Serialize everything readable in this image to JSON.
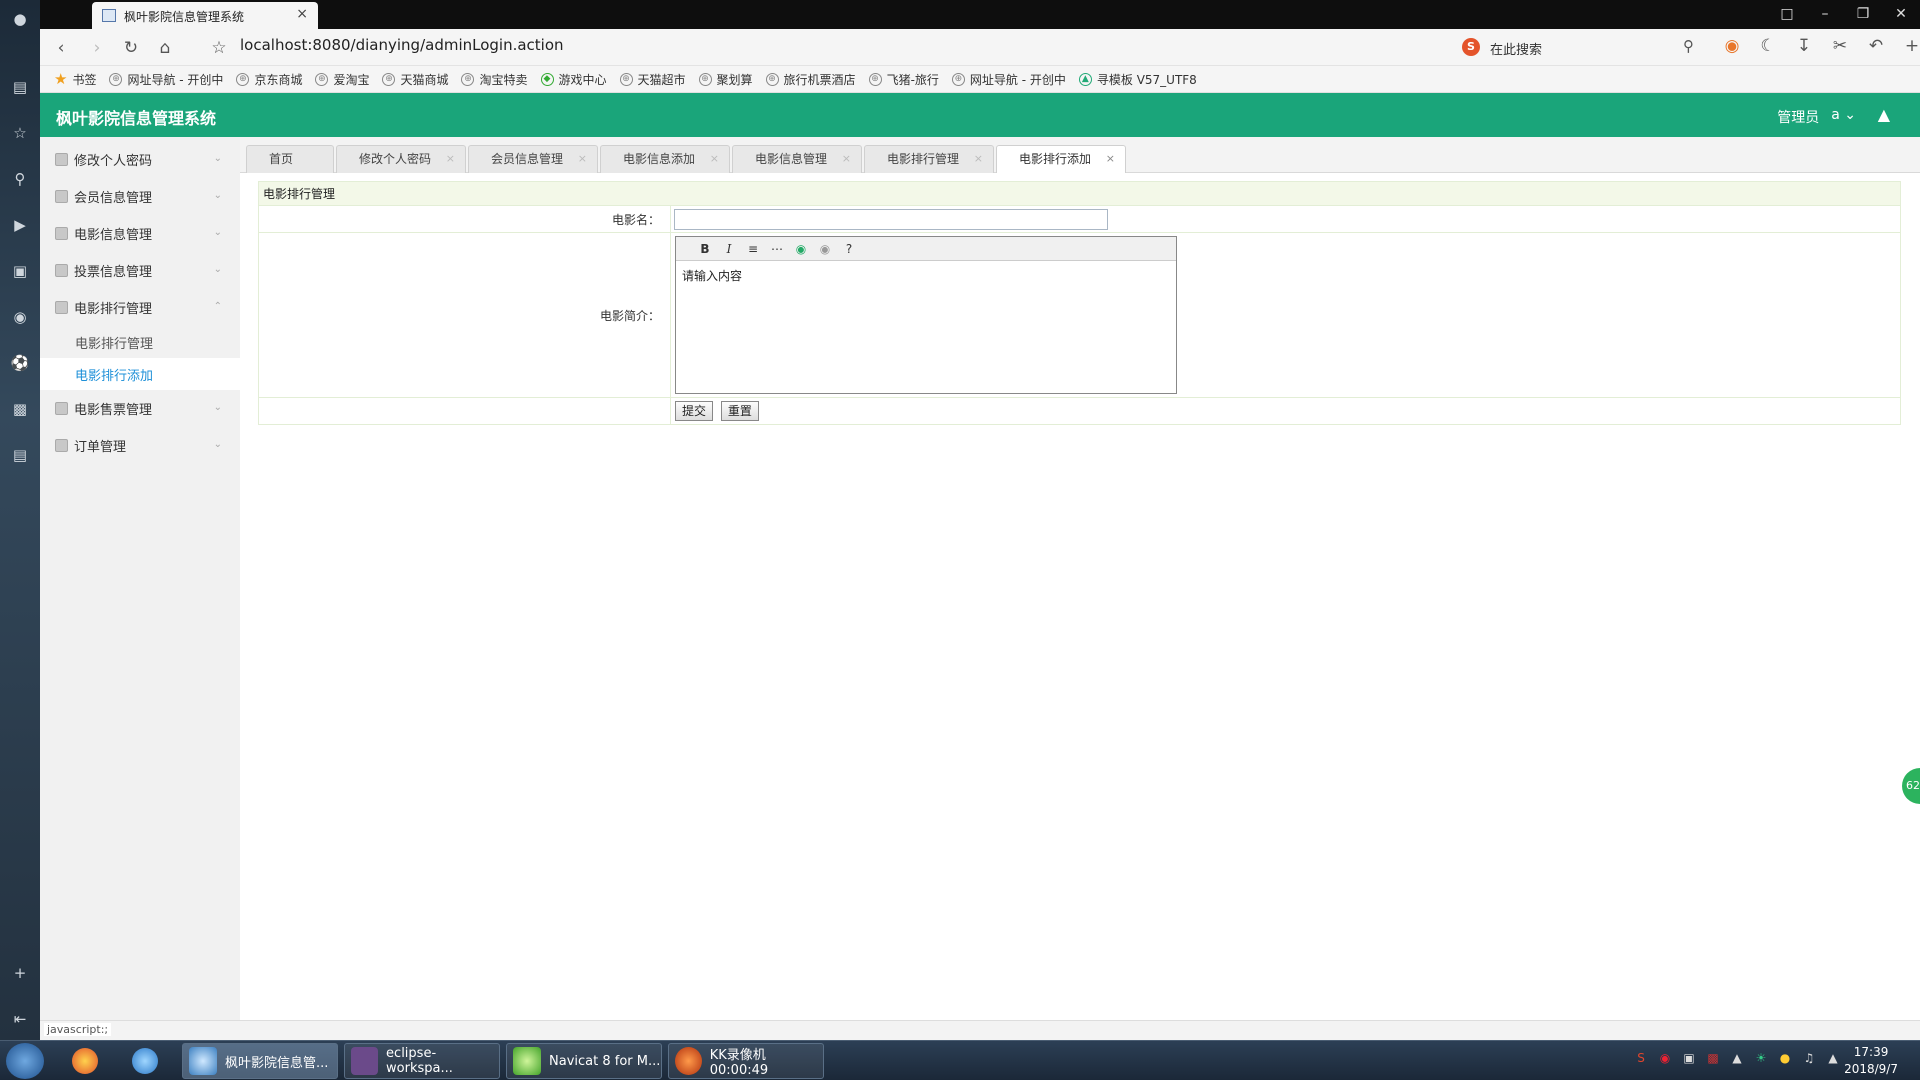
{
  "browser": {
    "tab_title": "枫叶影院信息管理系统",
    "address": "localhost:8080/dianying/adminLogin.action",
    "search_placeholder": "在此搜索",
    "bookmarks": [
      "书签",
      "网址导航 - 开创中",
      "京东商城",
      "爱淘宝",
      "天猫商城",
      "淘宝特卖",
      "游戏中心",
      "天猫超市",
      "聚划算",
      "旅行机票酒店",
      "飞猪-旅行",
      "网址导航 - 开创中",
      "寻模板 V57_UTF8"
    ],
    "status_text": "javascript:;"
  },
  "app": {
    "title": "枫叶影院信息管理系统",
    "user_role": "管理员",
    "user_name": "a"
  },
  "sidebar": {
    "items": [
      {
        "label": "修改个人密码"
      },
      {
        "label": "会员信息管理"
      },
      {
        "label": "电影信息管理"
      },
      {
        "label": "投票信息管理"
      },
      {
        "label": "电影排行管理"
      },
      {
        "label": "电影售票管理"
      },
      {
        "label": "订单管理"
      }
    ],
    "subitems": [
      {
        "label": "电影排行管理"
      },
      {
        "label": "电影排行添加"
      }
    ]
  },
  "content_tabs": [
    "首页",
    "修改个人密码",
    "会员信息管理",
    "电影信息添加",
    "电影信息管理",
    "电影排行管理",
    "电影排行添加"
  ],
  "form": {
    "caption": "电影排行管理",
    "name_label": "电影名：",
    "name_value": "",
    "intro_label": "电影简介：",
    "editor_placeholder": "请输入内容",
    "submit_label": "提交",
    "reset_label": "重置"
  },
  "taskbar": {
    "apps": [
      "枫叶影院信息管...",
      "eclipse-workspa...",
      "Navicat 8 for M...",
      "KK录像机 00:00:49"
    ],
    "time": "17:39",
    "date": "2018/9/7",
    "float_badge": "62"
  }
}
